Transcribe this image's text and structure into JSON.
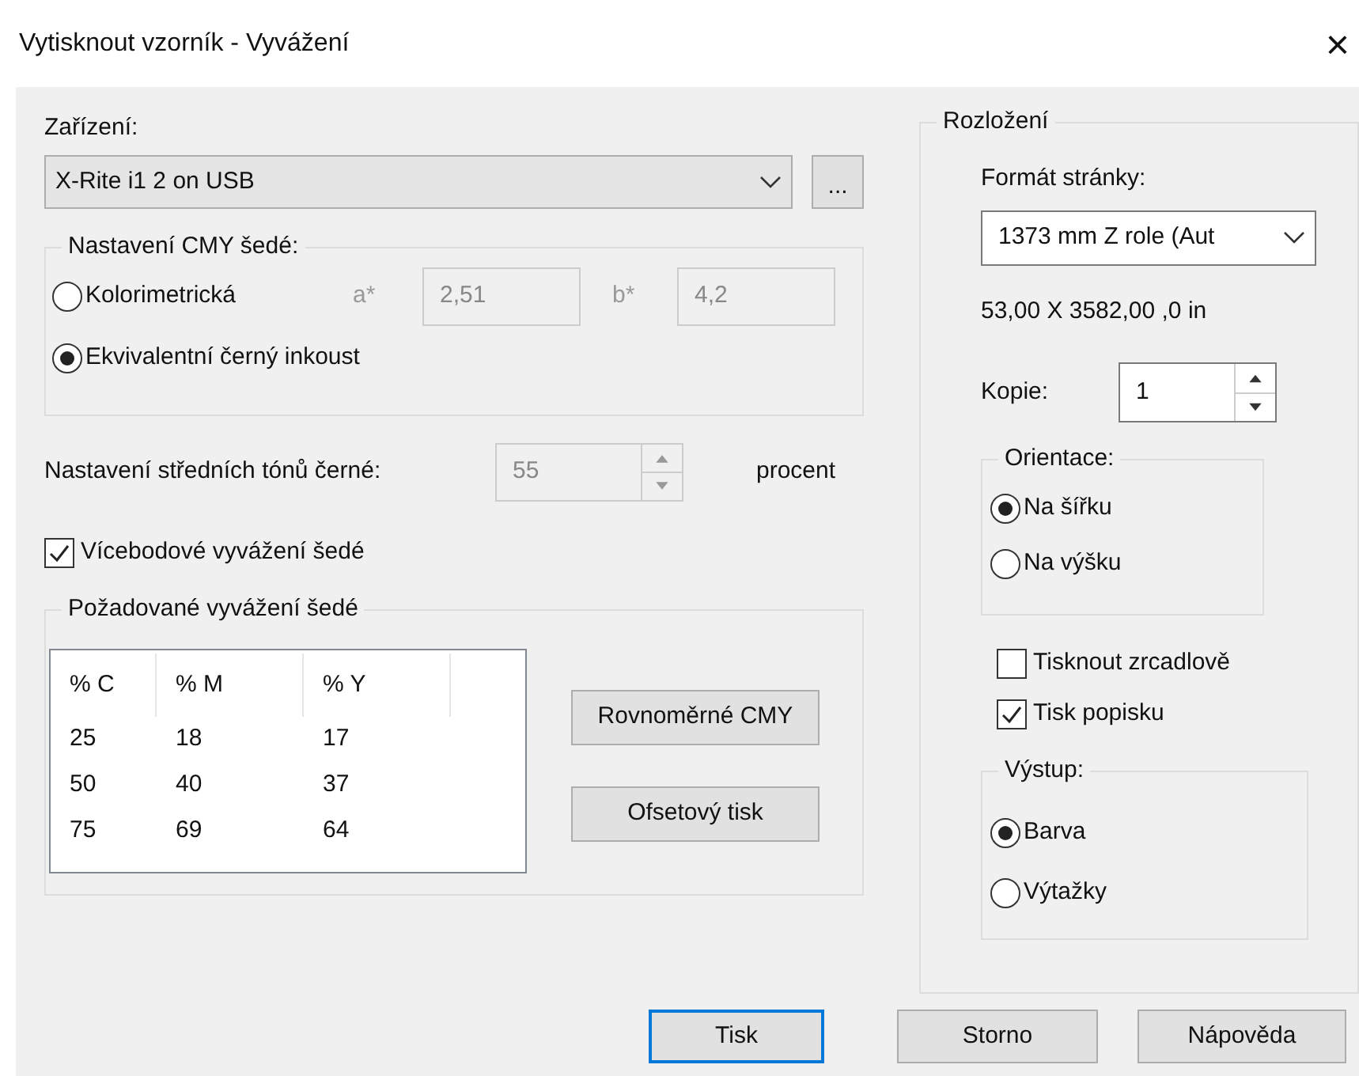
{
  "window": {
    "title": "Vytisknout vzorník - Vyvážení",
    "close": "×"
  },
  "device": {
    "label": "Zařízení:",
    "value": "X-Rite i1 2 on USB",
    "browse": "..."
  },
  "cmy_gray": {
    "legend": "Nastavení CMY šedé:",
    "options": [
      {
        "label": "Kolorimetrická",
        "selected": false
      },
      {
        "label": "Ekvivalentní černý inkoust",
        "selected": true
      }
    ],
    "fields_disabled": true,
    "a_label": "a*",
    "a_value": "2,51",
    "b_label": "b*",
    "b_value": "4,2"
  },
  "midtone": {
    "label": "Nastavení středních tónů černé:",
    "value": "55",
    "unit": "procent",
    "disabled": true
  },
  "multipoint": {
    "label": "Vícebodové vyvážení šedé",
    "checked": true
  },
  "desired_gray": {
    "legend": "Požadované vyvážení šedé",
    "columns": [
      "% C",
      "% M",
      "% Y"
    ],
    "rows": [
      [
        "25",
        "18",
        "17"
      ],
      [
        "50",
        "40",
        "37"
      ],
      [
        "75",
        "69",
        "64"
      ]
    ],
    "buttons": [
      "Rovnoměrné CMY",
      "Ofsetový tisk"
    ]
  },
  "layout": {
    "legend": "Rozložení",
    "page_format_label": "Formát stránky:",
    "page_format_value": "1373 mm Z role (Aut",
    "dimensions": "53,00 X 3582,00 ,0 in",
    "copies_label": "Kopie:",
    "copies_value": "1",
    "orientation": {
      "legend": "Orientace:",
      "options": [
        {
          "label": "Na šířku",
          "selected": true
        },
        {
          "label": "Na výšku",
          "selected": false
        }
      ]
    },
    "checkboxes": [
      {
        "label": "Tisknout zrcadlově",
        "checked": false
      },
      {
        "label": "Tisk popisku",
        "checked": true
      }
    ],
    "output": {
      "legend": "Výstup:",
      "options": [
        {
          "label": "Barva",
          "selected": true
        },
        {
          "label": "Výtažky",
          "selected": false
        }
      ]
    }
  },
  "footer_buttons": [
    {
      "label": "Tisk",
      "focused": true
    },
    {
      "label": "Storno",
      "focused": false
    },
    {
      "label": "Nápověda",
      "focused": false
    }
  ]
}
